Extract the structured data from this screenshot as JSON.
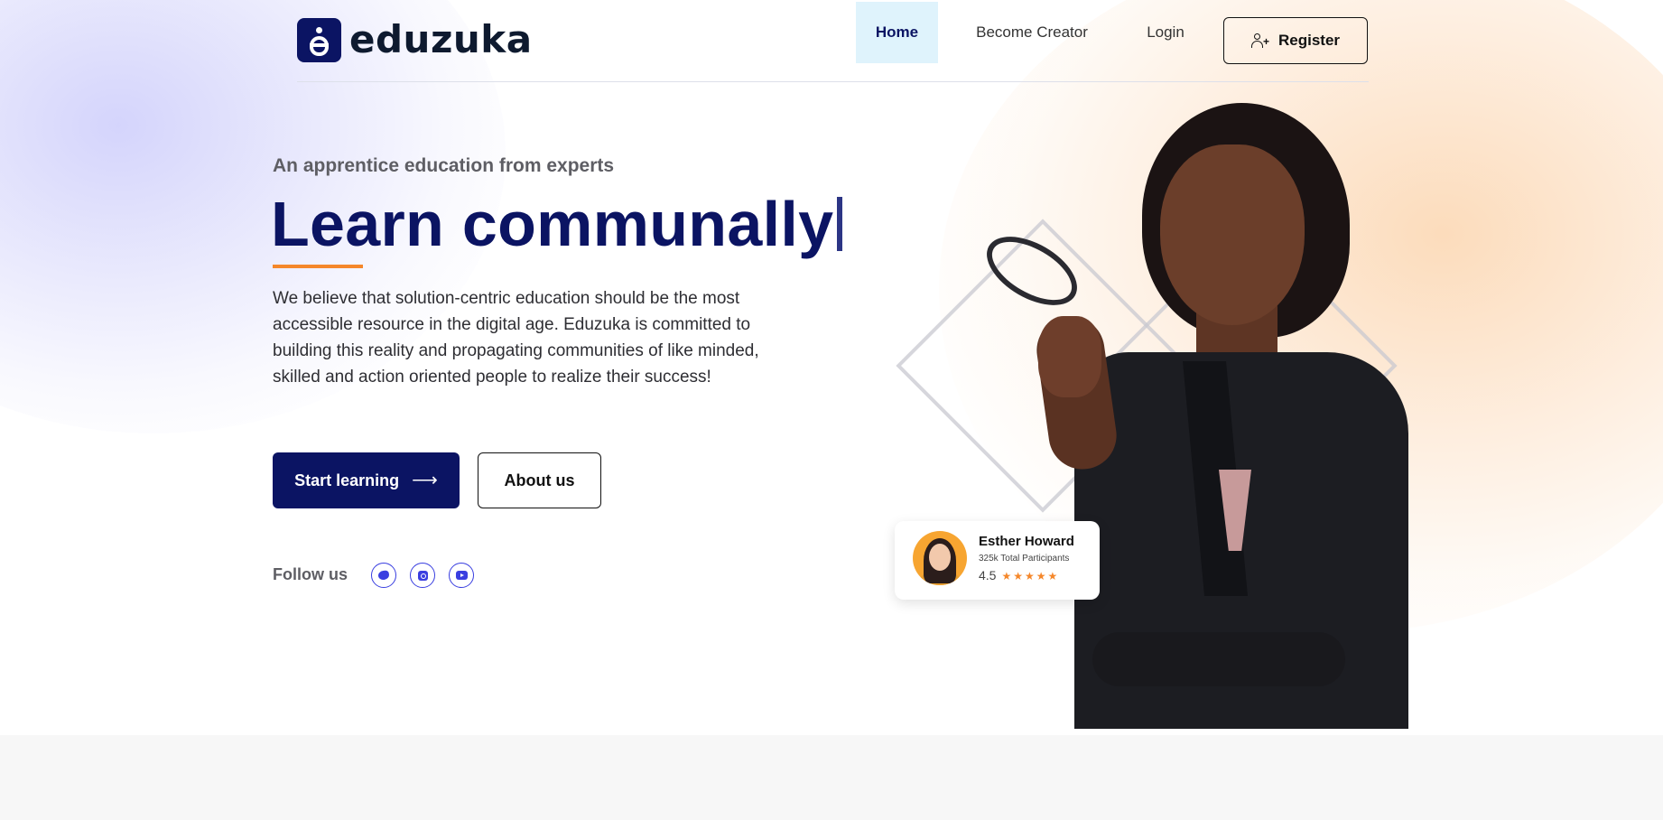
{
  "brand": {
    "name": "eduzuka",
    "logo_icon": "person-e-logo-icon",
    "primary_color": "#0b1463",
    "accent_color": "#f5872a"
  },
  "nav": {
    "items": [
      {
        "label": "Home",
        "active": true
      },
      {
        "label": "Become Creator",
        "active": false
      },
      {
        "label": "Login",
        "active": false
      }
    ],
    "register_label": "Register",
    "register_icon": "user-plus-icon"
  },
  "hero": {
    "eyebrow": "An apprentice education from experts",
    "headline": "Learn communally",
    "description": "We believe that solution-centric education should be the most accessible resource in the digital age. Eduzuka is committed to building this reality and propagating communities of like minded, skilled and action oriented people to realize their success!",
    "primary_cta": "Start learning",
    "primary_cta_icon": "arrow-right-icon",
    "secondary_cta": "About us",
    "follow_label": "Follow us",
    "socials": [
      {
        "name": "twitter",
        "icon": "twitter-icon"
      },
      {
        "name": "instagram",
        "icon": "instagram-icon"
      },
      {
        "name": "youtube",
        "icon": "youtube-icon"
      }
    ]
  },
  "instructor_card": {
    "name": "Esther Howard",
    "participants": "325k Total Participants",
    "rating": "4.5",
    "stars": 5
  }
}
